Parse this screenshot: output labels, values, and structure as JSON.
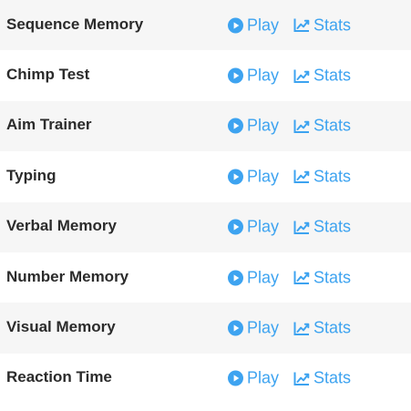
{
  "colors": {
    "link": "#3da3f0",
    "title": "#2b2b2b",
    "row_alt_background": "#f6f6f6"
  },
  "games": [
    {
      "title": "Sequence Memory",
      "play_label": "Play",
      "play_icon": "play-circle-icon",
      "stats_label": "Stats",
      "stats_icon": "line-chart-icon"
    },
    {
      "title": "Chimp Test",
      "play_label": "Play",
      "play_icon": "play-circle-icon",
      "stats_label": "Stats",
      "stats_icon": "line-chart-icon"
    },
    {
      "title": "Aim Trainer",
      "play_label": "Play",
      "play_icon": "play-circle-icon",
      "stats_label": "Stats",
      "stats_icon": "line-chart-icon"
    },
    {
      "title": "Typing",
      "play_label": "Play",
      "play_icon": "play-circle-icon",
      "stats_label": "Stats",
      "stats_icon": "line-chart-icon"
    },
    {
      "title": "Verbal Memory",
      "play_label": "Play",
      "play_icon": "play-circle-icon",
      "stats_label": "Stats",
      "stats_icon": "line-chart-icon"
    },
    {
      "title": "Number Memory",
      "play_label": "Play",
      "play_icon": "play-circle-icon",
      "stats_label": "Stats",
      "stats_icon": "line-chart-icon"
    },
    {
      "title": "Visual Memory",
      "play_label": "Play",
      "play_icon": "play-circle-icon",
      "stats_label": "Stats",
      "stats_icon": "line-chart-icon"
    },
    {
      "title": "Reaction Time",
      "play_label": "Play",
      "play_icon": "play-circle-icon",
      "stats_label": "Stats",
      "stats_icon": "line-chart-icon"
    }
  ]
}
